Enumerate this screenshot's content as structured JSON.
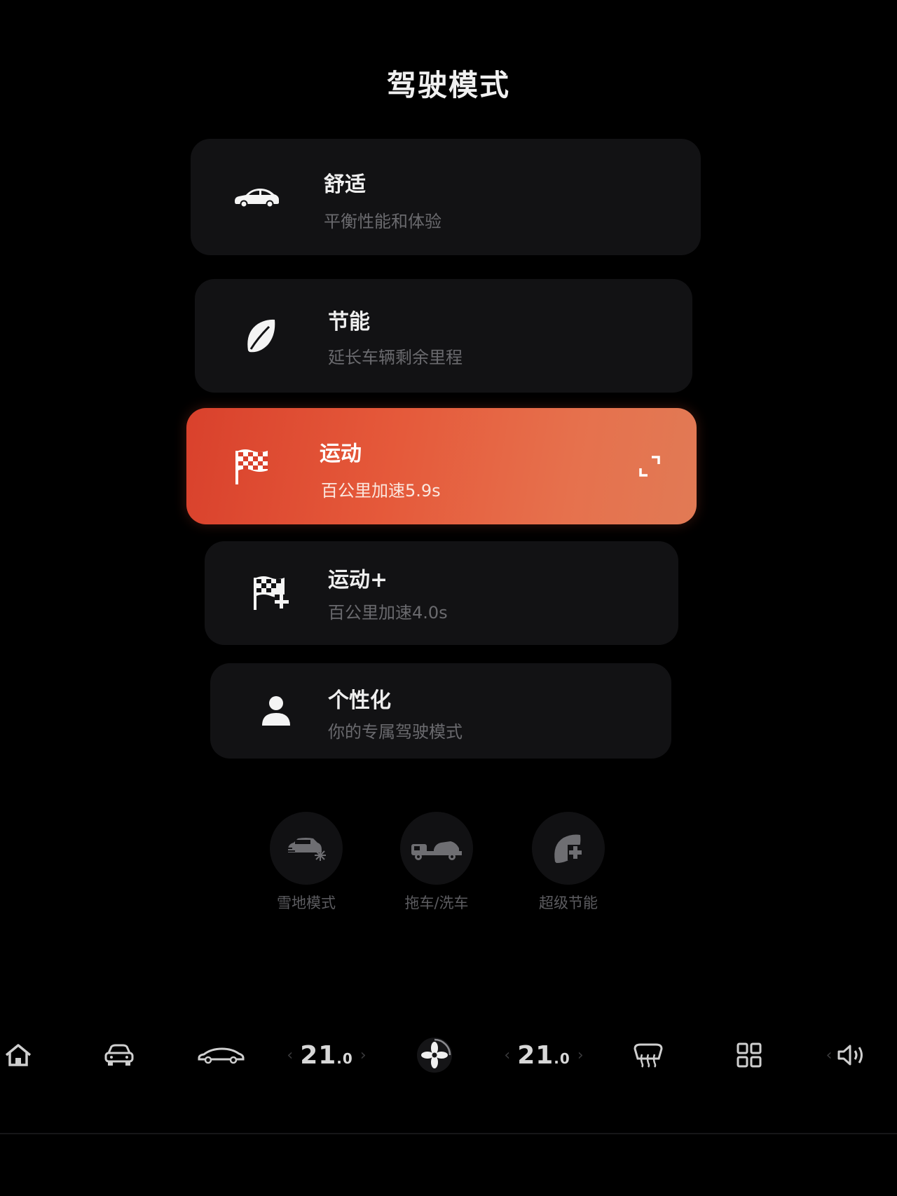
{
  "page": {
    "title": "驾驶模式"
  },
  "modes": [
    {
      "name": "舒适",
      "desc": "平衡性能和体验",
      "icon": "car-icon",
      "active": false
    },
    {
      "name": "节能",
      "desc": "延长车辆剩余里程",
      "icon": "leaf-icon",
      "active": false
    },
    {
      "name": "运动",
      "desc": "百公里加速5.9s",
      "icon": "checkered-flag-icon",
      "active": true
    },
    {
      "name": "运动+",
      "desc": "百公里加速4.0s",
      "icon": "checkered-flag-plus-icon",
      "active": false
    },
    {
      "name": "个性化",
      "desc": "你的专属驾驶模式",
      "icon": "person-icon",
      "active": false
    }
  ],
  "quick_actions": [
    {
      "label": "雪地模式",
      "icon": "snow-car-icon"
    },
    {
      "label": "拖车/洗车",
      "icon": "tow-truck-icon"
    },
    {
      "label": "超级节能",
      "icon": "super-eco-leaf-icon"
    }
  ],
  "dock": {
    "left_temp": {
      "int": "21",
      "dec": ".0"
    },
    "right_temp": {
      "int": "21",
      "dec": ".0"
    },
    "icons": [
      "home-icon",
      "car-front-icon",
      "car-side-icon",
      "fan-icon",
      "defrost-icon",
      "apps-grid-icon",
      "volume-icon"
    ]
  },
  "colors": {
    "accent": "#e5593a",
    "card_bg": "#121214",
    "background": "#000000"
  }
}
